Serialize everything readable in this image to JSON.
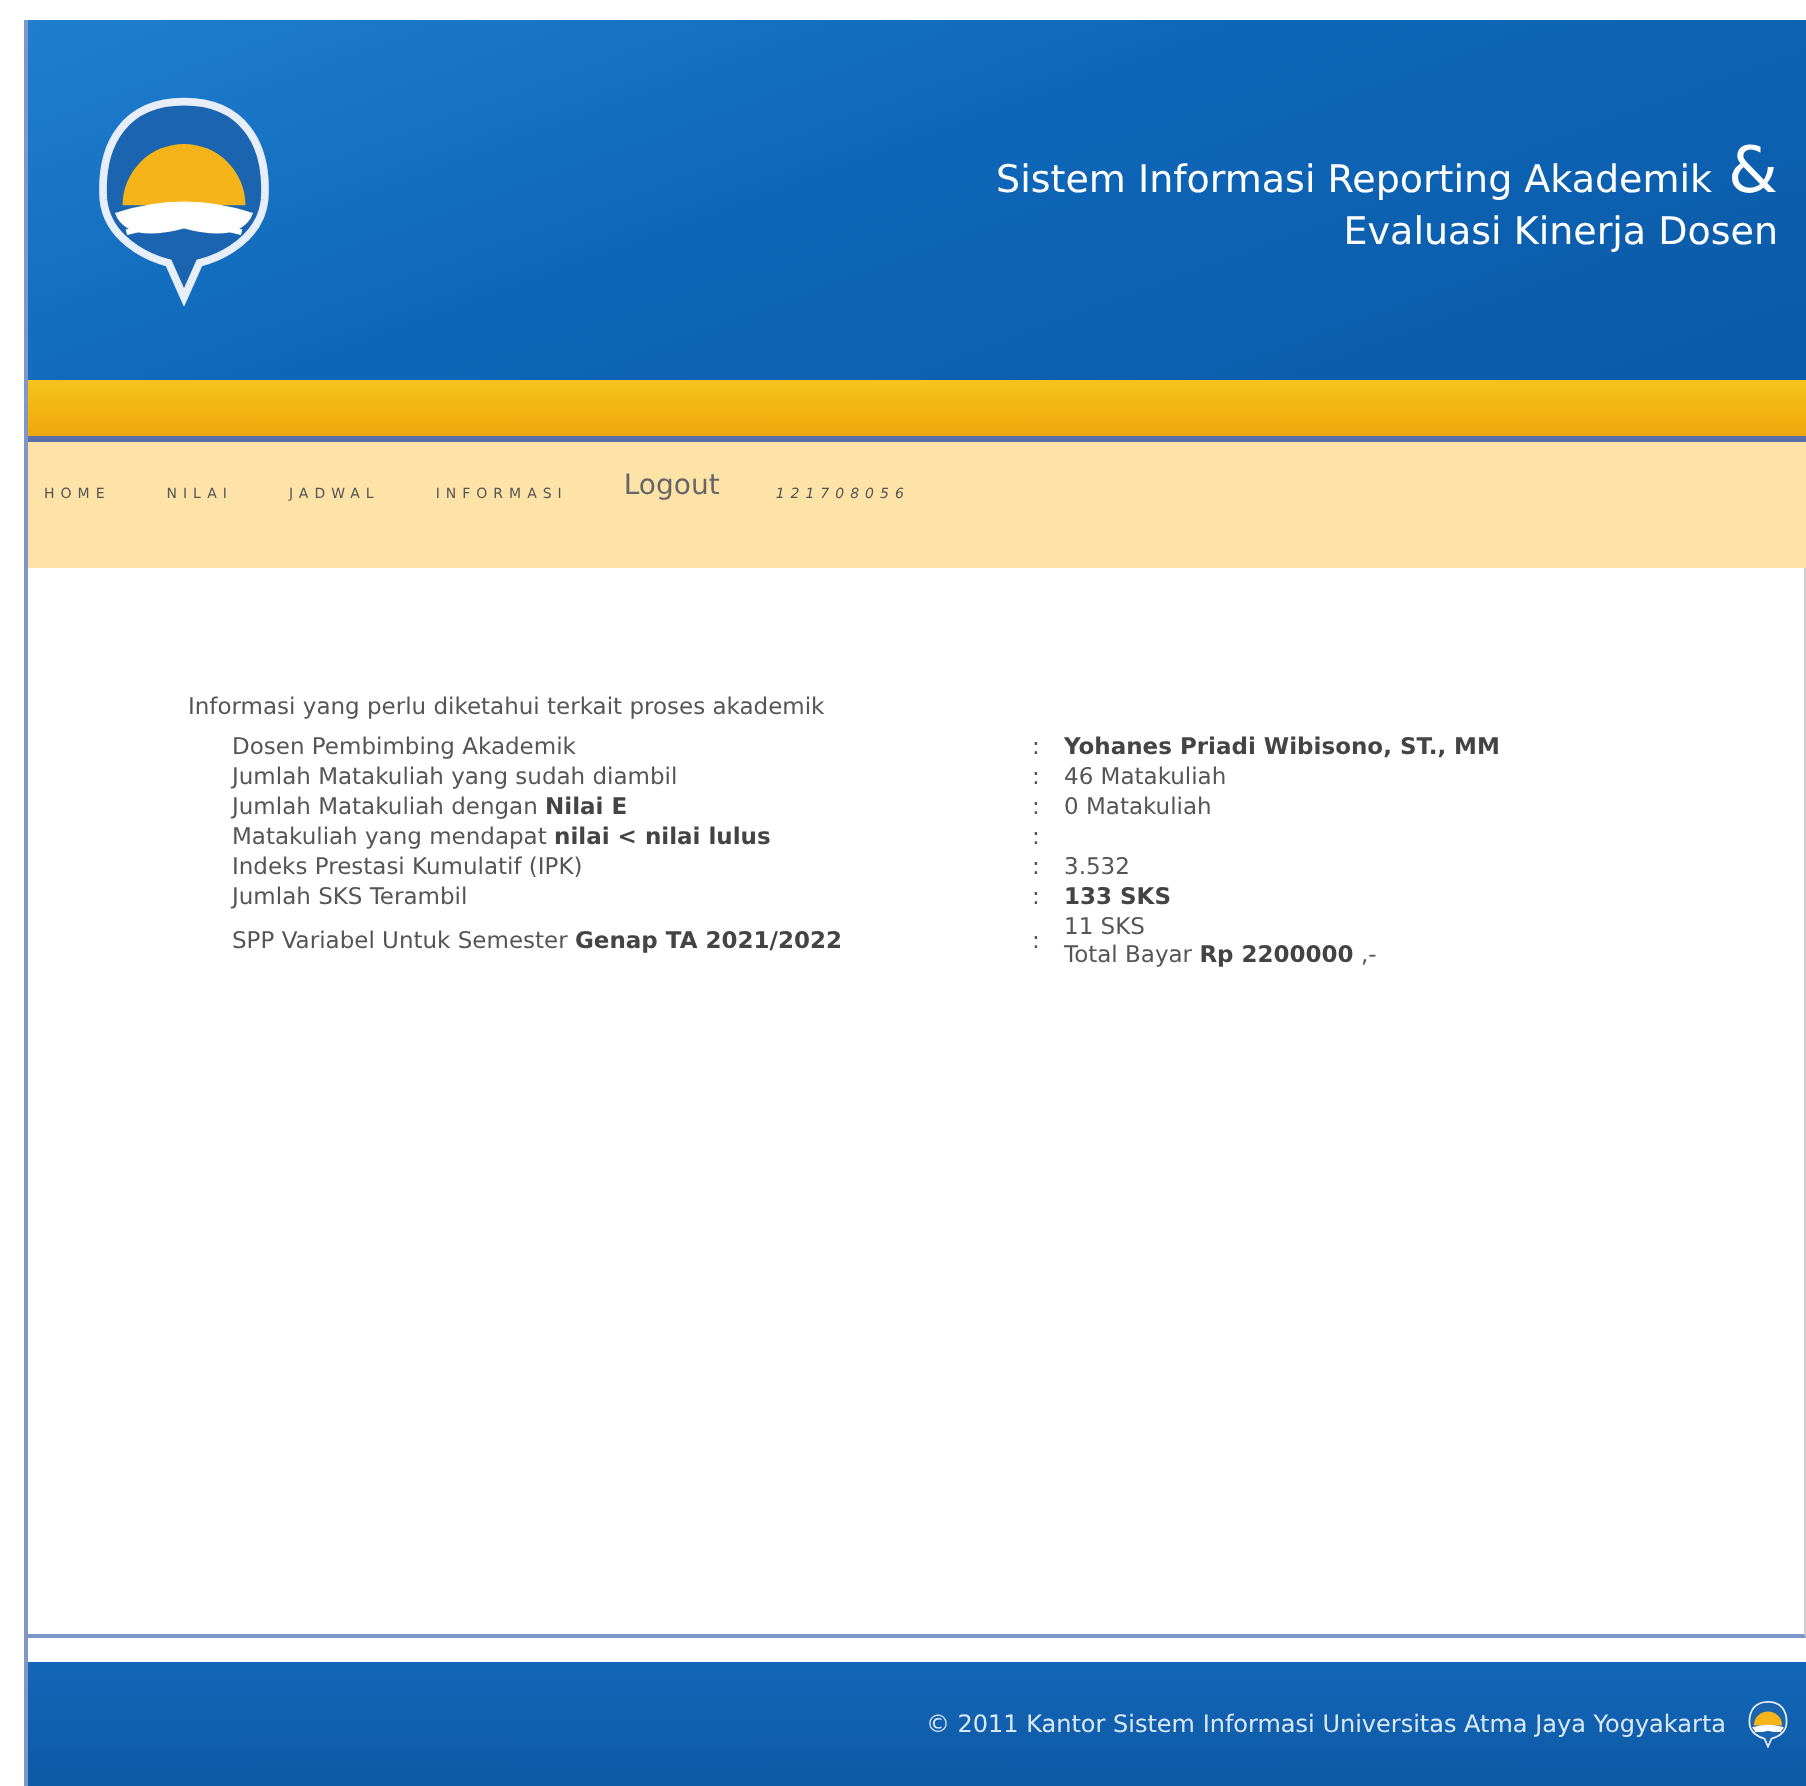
{
  "header": {
    "title_line_1": "Sistem Informasi Reporting Akademik",
    "ampersand": "&",
    "title_line_2": "Evaluasi Kinerja Dosen"
  },
  "nav": [
    {
      "label": "HOME",
      "kind": "menu"
    },
    {
      "label": "NILAI",
      "kind": "menu"
    },
    {
      "label": "JADWAL",
      "kind": "menu"
    },
    {
      "label": "INFORMASI",
      "kind": "menu"
    },
    {
      "label": "Logout",
      "kind": "logout"
    },
    {
      "label": "121708056",
      "kind": "user"
    }
  ],
  "info": {
    "heading": "Informasi yang perlu diketahui terkait proses akademik",
    "rows": [
      {
        "label": "Dosen Pembimbing Akademik",
        "values": [
          "Yohanes Priadi Wibisono, ST., MM"
        ],
        "bold": true
      },
      {
        "label": "Jumlah Matakuliah yang sudah diambil",
        "values": [
          "46 Matakuliah"
        ],
        "bold": false
      },
      {
        "label": "Jumlah Matakuliah dengan **Nilai E**",
        "values": [
          "0 Matakuliah"
        ],
        "bold": false
      },
      {
        "label": "Matakuliah yang mendapat **nilai < nilai lulus**"
      },
      {
        "label": "Indeks Prestasi Kumulatif (IPK)",
        "values": [
          "3.532"
        ],
        "bold": false
      },
      {
        "label": "Jumlah SKS Terambil",
        "values": [
          "133 SKS"
        ],
        "bold": true
      },
      {
        "label": "SPP Variabel Untuk Semester **Genap TA 2021/2022**",
        "values": [
          "11 SKS",
          "Total Bayar **Rp 2200000** ,-"
        ],
        "bold": false
      }
    ],
    "separator": ":"
  },
  "footer": {
    "text": "© 2011 Kantor Sistem Informasi Universitas Atma Jaya Yogyakarta"
  }
}
